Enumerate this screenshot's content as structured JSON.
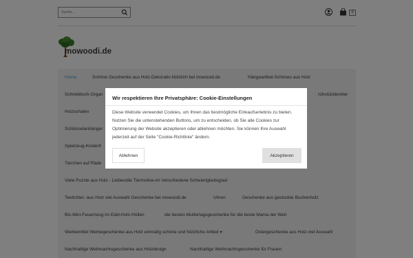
{
  "header": {
    "search_placeholder": "Suche...",
    "cart_count": "0"
  },
  "logo": {
    "text": "mowoodi.de"
  },
  "nav": {
    "items": [
      "Home",
      "Schöne Geschenke aus Holz-Dekorativ-Nützlich bei mowoodi.de",
      "Hängeartikel-Schönes aus Holz",
      "Schreibtisch-Organ",
      "rühstückbretter",
      "Holzschalen",
      "Schlüsselanhänger",
      "Spielzeug-Kinderfr",
      "Tierchen auf Räde",
      "Viele Puzzle aus Holz - Liebevolle Tiermotive-im Verschiedene Schwierigkeitsgrad",
      "Teelichter- aus Holz viel Auswahl Geschenke bei mowoodi.de",
      "Uhren",
      "Geschenke aus gestockte Buchenholz",
      "Bic-Mini-Feuerzeug im Edel-Holz-Hüllen",
      "die besten Muttertagsgeschenke für die beste Mama der Welt",
      "Werbemittel Werbegeschenke aus Holz einmalig schöne und Nützliche Artikel",
      "Ostergeschenke aus Holz-viel Auswahl",
      "Nachhaltige Weihnachtsgeschenke aus Holzdesign",
      "Nachhaltige Weihnachtsgeschenke für Frauen"
    ]
  },
  "cookie": {
    "title": "Wir respektieren Ihre Privatsphäre: Cookie-Einstellungen",
    "text": "Diese Website verwendet Cookies, um Ihnen das bestmögliche Einkaufserlebnis zu bieten. Nutzen Sie die untenstehenden Buttons, um zu entscheiden, ob Sie alle Cookies zur Optimierung der Website akzeptieren oder ablehnen möchten. Sie können Ihre Auswahl jederzeit auf der Seite \"Cookie-Richtlinie\" ändern.",
    "decline_label": "Ablehnen",
    "accept_label": "Akzeptieren"
  },
  "colors": {
    "nav_active": "#4a9bc7",
    "overlay": "rgba(0,0,0,0.5)"
  }
}
